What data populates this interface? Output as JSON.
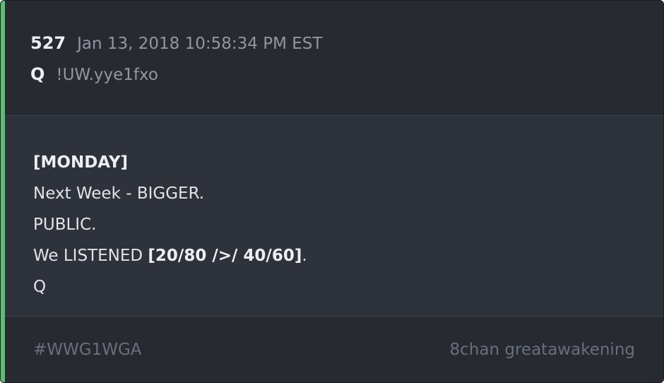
{
  "post": {
    "number": "527",
    "timestamp": "Jan 13, 2018 10:58:34 PM EST",
    "author": "Q",
    "tripcode": "!UW.yye1fxo"
  },
  "body": {
    "line1": "[MONDAY]",
    "line2": "Next Week - BIGGER.",
    "line3": "PUBLIC.",
    "line4_prefix": "We LISTENED ",
    "line4_bold": "[20/80 />/ 40/60]",
    "line4_suffix": ".",
    "line5": "Q"
  },
  "footer": {
    "hashtag": "#WWG1WGA",
    "source": "8chan greatawakening"
  },
  "colors": {
    "accent": "#5bbe70",
    "card_background": "#2e323b",
    "header_background": "#272a31"
  }
}
